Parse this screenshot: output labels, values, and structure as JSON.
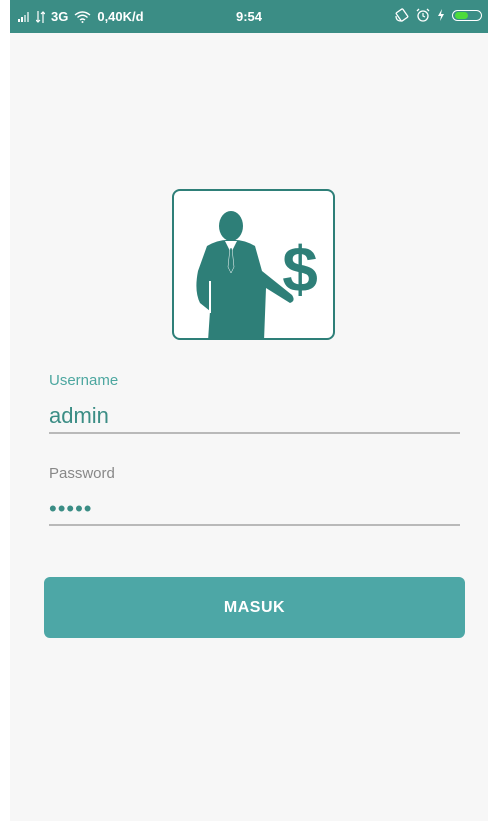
{
  "status_bar": {
    "network_type": "3G",
    "speed": "0,40K/d",
    "time": "9:54",
    "battery_level": 0.55,
    "icons": [
      "signal-icon",
      "signal-arrows-icon",
      "wifi-icon",
      "rotate-icon",
      "alarm-icon",
      "charging-icon",
      "battery-icon"
    ]
  },
  "logo": {
    "icon": "businessman-dollar-icon"
  },
  "form": {
    "username_label": "Username",
    "username_value": "admin",
    "password_label": "Password",
    "password_value": "•••••"
  },
  "login_button_label": "MASUK",
  "colors": {
    "status_bar": "#3b8d85",
    "accent": "#4da7a0",
    "button": "#4da7a6",
    "logo": "#2e7f78",
    "background": "#f7f7f7"
  }
}
